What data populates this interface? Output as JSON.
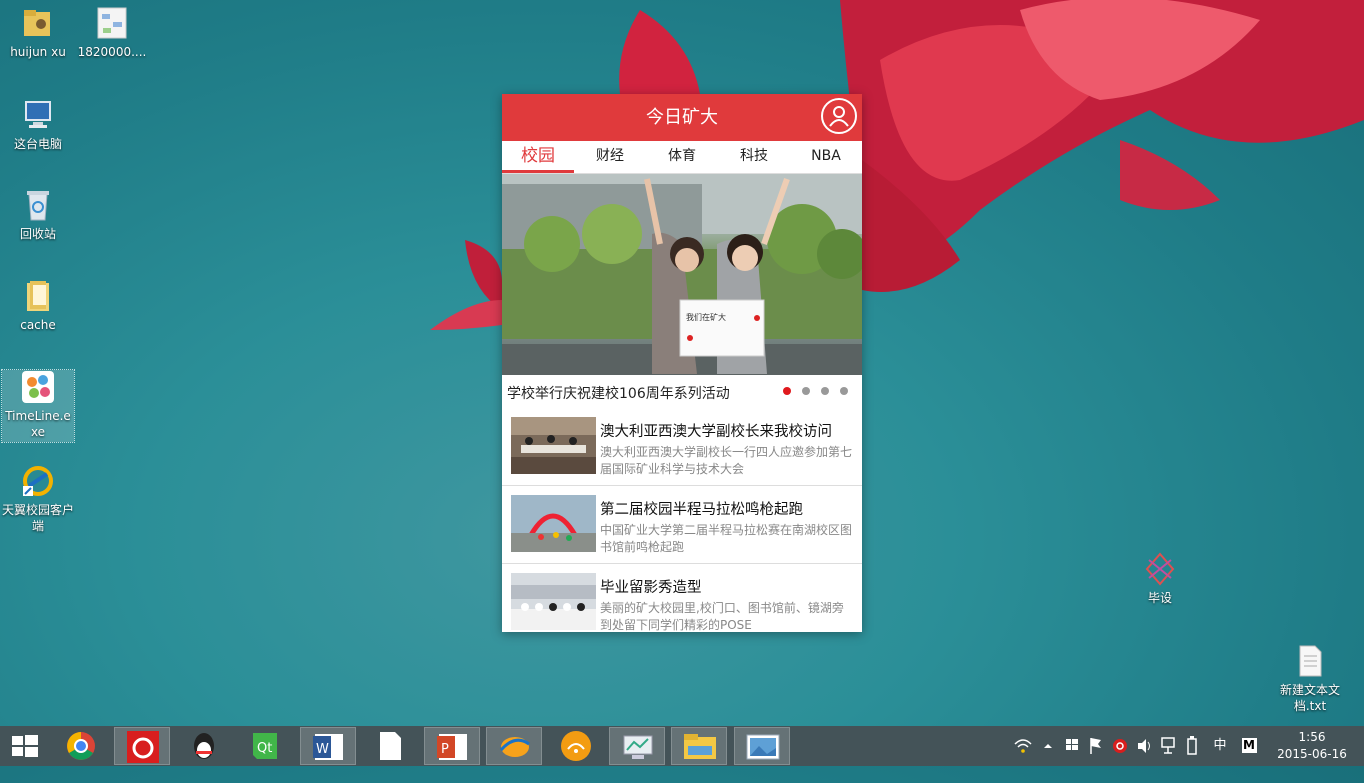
{
  "desktop": {
    "icons": [
      {
        "label": "huijun xu",
        "icon": "folder-icon"
      },
      {
        "label": "1820000....",
        "icon": "image-file-icon"
      },
      {
        "label": "这台电脑",
        "icon": "computer-icon"
      },
      {
        "label": "回收站",
        "icon": "recycle-bin-icon"
      },
      {
        "label": "cache",
        "icon": "folder-icon"
      },
      {
        "label": "TimeLine.exe",
        "icon": "timeline-app-icon"
      },
      {
        "label": "天翼校园客户端",
        "icon": "tianyi-client-icon"
      },
      {
        "label": "毕设",
        "icon": "bishe-app-icon"
      },
      {
        "label": "新建文本文档.txt",
        "icon": "text-file-icon"
      }
    ]
  },
  "app": {
    "title": "今日矿大",
    "tabs": [
      "校园",
      "财经",
      "体育",
      "科技",
      "NBA"
    ],
    "active_tab": "校园",
    "hero": {
      "caption": "学校举行庆祝建校106周年系列活动",
      "sign_text": "我们在矿大",
      "slides": 4,
      "active_slide": 1
    },
    "news": [
      {
        "title": "澳大利亚西澳大学副校长来我校访问",
        "desc": "澳大利亚西澳大学副校长一行四人应邀参加第七届国际矿业科学与技术大会"
      },
      {
        "title": "第二届校园半程马拉松鸣枪起跑",
        "desc": "中国矿业大学第二届半程马拉松赛在南湖校区图书馆前鸣枪起跑"
      },
      {
        "title": "毕业留影秀造型",
        "desc": "美丽的矿大校园里,校门口、图书馆前、镜湖旁到处留下同学们精彩的POSE"
      }
    ]
  },
  "taskbar": {
    "apps": [
      "start-button",
      "chrome-icon",
      "netease-music-icon",
      "qq-icon",
      "qt-icon",
      "word-icon",
      "file-icon",
      "powerpoint-icon",
      "browser-icon",
      "wifi-app-icon",
      "monitor-icon",
      "explorer-icon",
      "photo-viewer-icon"
    ],
    "tray": {
      "ime": "中",
      "ime_mode": "M"
    },
    "clock": {
      "time": "1:56",
      "date": "2015-06-16"
    }
  },
  "colors": {
    "accent": "#e03a3c",
    "taskbar": "#445358"
  }
}
